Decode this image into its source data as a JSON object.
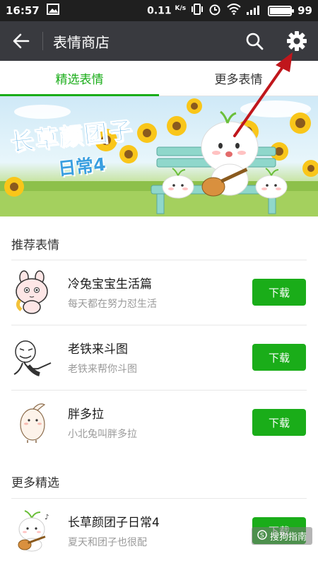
{
  "status_bar": {
    "time": "16:57",
    "network_speed": "0.11",
    "network_unit": "K/s",
    "battery": "99"
  },
  "app_bar": {
    "title": "表情商店",
    "back_icon": "arrow-left-icon",
    "search_icon": "search-icon",
    "settings_icon": "gear-icon"
  },
  "tabs": [
    {
      "label": "精选表情",
      "active": true
    },
    {
      "label": "更多表情",
      "active": false
    }
  ],
  "banner": {
    "title": "长草颜团子",
    "subtitle": "日常4"
  },
  "sections": {
    "recommended_title": "推荐表情",
    "more_title": "更多精选"
  },
  "recommended": [
    {
      "name": "冷兔宝宝生活篇",
      "desc": "每天都在努力怼生活",
      "button": "下载"
    },
    {
      "name": "老铁来斗图",
      "desc": "老铁来帮你斗图",
      "button": "下载"
    },
    {
      "name": "胖多拉",
      "desc": "小北兔叫胖多拉",
      "button": "下载"
    }
  ],
  "more": [
    {
      "name": "长草颜团子日常4",
      "desc": "夏天和团子也很配",
      "button": "下载"
    }
  ],
  "watermark": "搜狗指南",
  "colors": {
    "accent": "#1aad19",
    "app_bar": "#393a3f",
    "status_bar": "#1f1f1f",
    "annotation_arrow": "#c0161c"
  }
}
